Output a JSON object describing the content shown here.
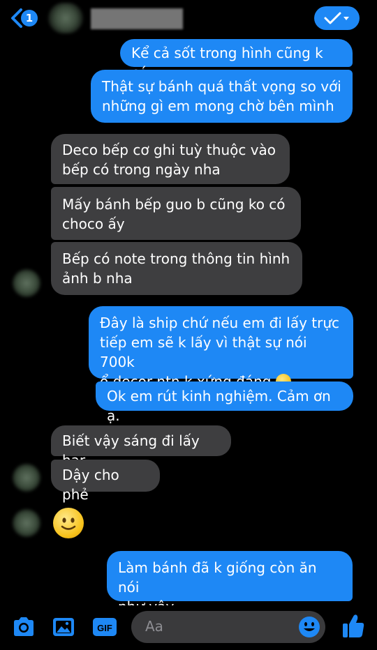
{
  "header": {
    "unread_count": "1",
    "accent": "#1e88f5"
  },
  "messages": [
    {
      "id": "m1",
      "side": "out",
      "text": "Kể cả sốt trong hình cũng k có"
    },
    {
      "id": "m2",
      "side": "out",
      "lines": [
        "Thật sự bánh quá thất vọng so với",
        "những gì em mong chờ bên mình"
      ]
    },
    {
      "id": "m3",
      "side": "in",
      "lines": [
        "Deco bếp cơ ghi tuỳ thuộc vào",
        "bếp có trong ngày nha"
      ]
    },
    {
      "id": "m4",
      "side": "in",
      "lines": [
        "Mấy bánh bếp guo b cũng ko có",
        "choco ấy"
      ]
    },
    {
      "id": "m5",
      "side": "in",
      "lines": [
        "Bếp có note trong thông tin hình",
        "ảnh b nha"
      ]
    },
    {
      "id": "m6",
      "side": "out",
      "lines": [
        "Đây là ship chứ nếu em đi lấy trực",
        "tiếp em sẽ k lấy vì thật sự nói 700k",
        "ổ decor ntn k xứng đáng"
      ],
      "emoji": "slightly-smiling-face"
    },
    {
      "id": "m7",
      "side": "out",
      "text": "Ok em rút kinh nghiệm. Cảm ơn ạ."
    },
    {
      "id": "m8",
      "side": "in",
      "text": "Biết vậy sáng đi lấy har"
    },
    {
      "id": "m9",
      "side": "in",
      "text": "Dậy cho phẻ"
    },
    {
      "id": "m10",
      "side": "in",
      "emoji": "slightly-smiling-face"
    },
    {
      "id": "m11",
      "side": "out",
      "lines": [
        "Làm bánh đã k giống còn ăn nói",
        "như vậy."
      ]
    }
  ],
  "composer": {
    "placeholder": "Aa",
    "icons": [
      "camera-icon",
      "gallery-icon",
      "gif-icon",
      "emoji-icon",
      "thumbs-up-icon"
    ]
  },
  "colors": {
    "outgoing_bubble": "#1e88f5",
    "incoming_bubble": "#3e3e40",
    "background": "#000000"
  }
}
